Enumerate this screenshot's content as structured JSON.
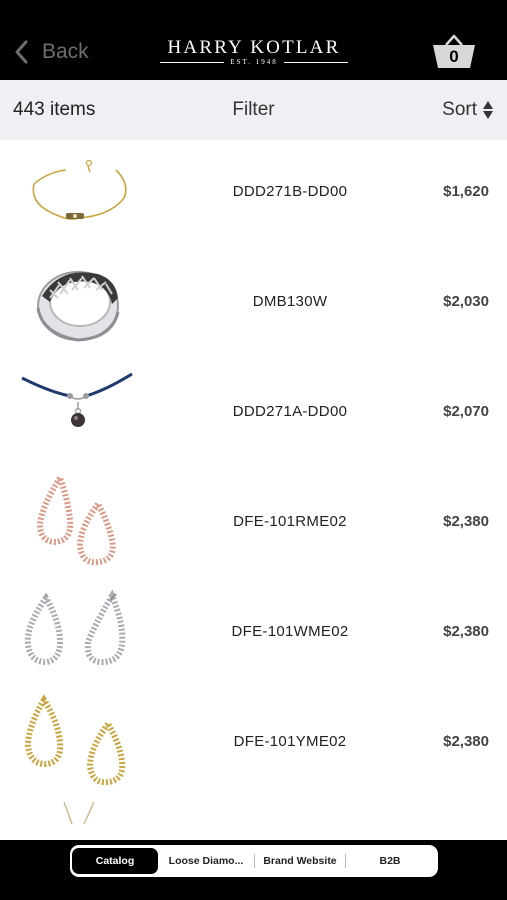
{
  "header": {
    "back_label": "Back",
    "brand_name": "HARRY KOTLAR",
    "brand_subtitle": "EST. 1948",
    "cart_count": "0"
  },
  "toolbar": {
    "item_count": "443 items",
    "filter_label": "Filter",
    "sort_label": "Sort"
  },
  "products": [
    {
      "sku": "DDD271B-DD00",
      "price": "$1,620",
      "image": "gold-bracelet"
    },
    {
      "sku": "DMB130W",
      "price": "$2,030",
      "image": "white-gold-band-ring"
    },
    {
      "sku": "DDD271A-DD00",
      "price": "$2,070",
      "image": "blue-cord-pendant"
    },
    {
      "sku": "DFE-101RME02",
      "price": "$2,380",
      "image": "rose-gold-drop-earrings"
    },
    {
      "sku": "DFE-101WME02",
      "price": "$2,380",
      "image": "white-gold-drop-earrings"
    },
    {
      "sku": "DFE-101YME02",
      "price": "$2,380",
      "image": "yellow-gold-drop-earrings"
    }
  ],
  "tabs": [
    {
      "label": "Catalog",
      "active": true
    },
    {
      "label": "Loose Diamo...",
      "active": false
    },
    {
      "label": "Brand Website",
      "active": false
    },
    {
      "label": "B2B",
      "active": false
    }
  ],
  "colors": {
    "header_bg": "#000000",
    "toolbar_bg": "#efeff4",
    "rose_gold": "#d99a88",
    "white_gold": "#a8abb0",
    "yellow_gold": "#c9a640"
  }
}
